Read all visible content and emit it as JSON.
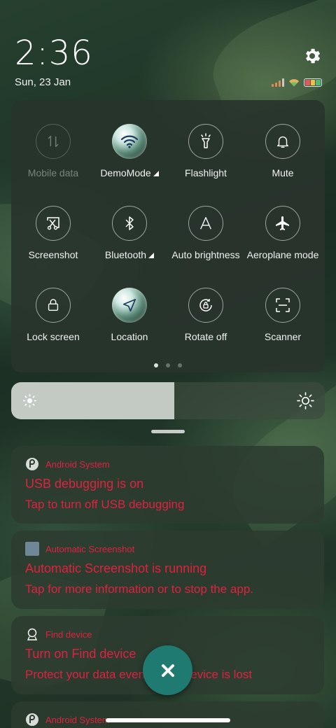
{
  "status": {
    "time": "2:36",
    "date": "Sun, 23 Jan"
  },
  "tiles": [
    {
      "label": "Mobile data",
      "icon": "mobile-data-icon",
      "state": "disabled"
    },
    {
      "label": "DemoMode",
      "icon": "wifi-icon",
      "state": "active",
      "has_menu": true
    },
    {
      "label": "Flashlight",
      "icon": "flashlight-icon",
      "state": "off"
    },
    {
      "label": "Mute",
      "icon": "bell-icon",
      "state": "off"
    },
    {
      "label": "Screenshot",
      "icon": "screenshot-icon",
      "state": "off"
    },
    {
      "label": "Bluetooth",
      "icon": "bluetooth-icon",
      "state": "off",
      "has_menu": true
    },
    {
      "label": "Auto brightness",
      "icon": "auto-brightness-icon",
      "state": "off"
    },
    {
      "label": "Aeroplane mode",
      "icon": "airplane-icon",
      "state": "off"
    },
    {
      "label": "Lock screen",
      "icon": "lock-icon",
      "state": "off"
    },
    {
      "label": "Location",
      "icon": "location-icon",
      "state": "active"
    },
    {
      "label": "Rotate off",
      "icon": "rotate-icon",
      "state": "off"
    },
    {
      "label": "Scanner",
      "icon": "scanner-icon",
      "state": "off"
    }
  ],
  "pager": {
    "pages": 3,
    "current": 1
  },
  "brightness": {
    "level": 0.52
  },
  "notifications": [
    {
      "app": "Android System",
      "title": "USB debugging is on",
      "text": "Tap to turn off USB debugging"
    },
    {
      "app": "Automatic Screenshot",
      "title": "Automatic Screenshot is running",
      "text": "Tap for more information or to stop the app."
    },
    {
      "app": "Find device",
      "title": "Turn on Find device",
      "text": "Protect your data even if your device is lost"
    },
    {
      "app": "Android System",
      "title": "",
      "text": ""
    }
  ],
  "colors": {
    "notification_text": "#e0213f",
    "fab": "#1f7a72",
    "panel": "#28342c"
  }
}
